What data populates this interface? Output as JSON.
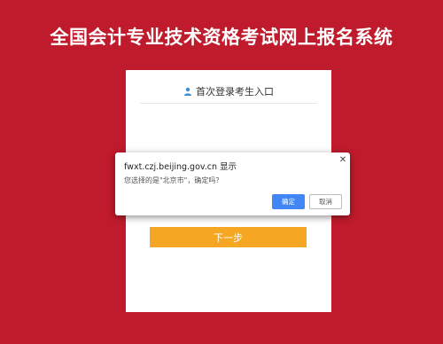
{
  "header": {
    "title": "全国会计专业技术资格考试网上报名系统"
  },
  "login_card": {
    "header_label": "首次登录考生入口",
    "header_icon": "user-icon",
    "next_button_label": "下一步"
  },
  "dialog": {
    "title": "fwxt.czj.beijing.gov.cn 显示",
    "message": "您选择的是\"北京市\"，确定吗？",
    "ok_label": "确定",
    "cancel_label": "取消",
    "close_icon": "close-icon"
  },
  "colors": {
    "background": "#bf1b2c",
    "next_button": "#f5a623",
    "ok_button": "#4285f4",
    "user_icon": "#3b8fd8"
  }
}
